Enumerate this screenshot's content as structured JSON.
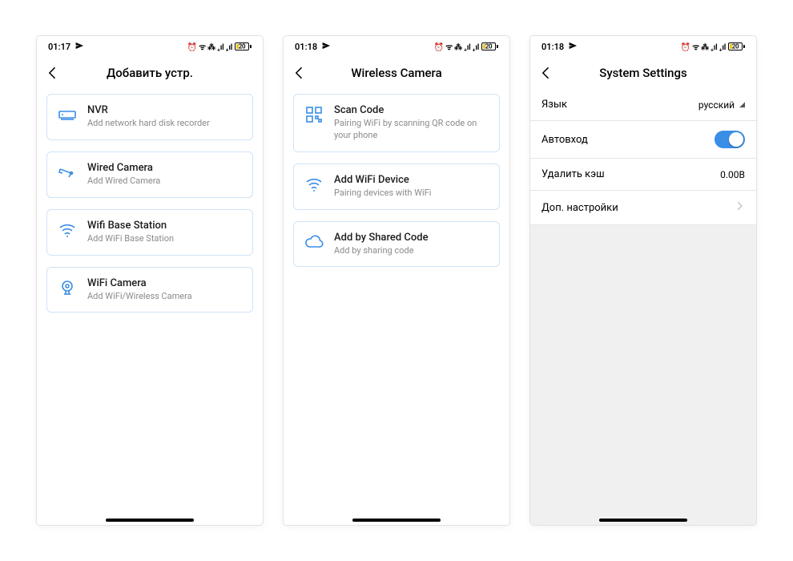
{
  "screens": [
    {
      "status": {
        "time": "01:17",
        "icons": "⏰ ᯤ ⁂ ₊ıl ₊ıl",
        "battery_pct": "20"
      },
      "nav": {
        "title": "Добавить устр."
      },
      "cards": [
        {
          "icon": "nvr-icon",
          "title": "NVR",
          "sub": "Add network hard disk recorder"
        },
        {
          "icon": "wired-cam-icon",
          "title": "Wired Camera",
          "sub": "Add Wired Camera"
        },
        {
          "icon": "wifi-base-icon",
          "title": "Wifi Base Station",
          "sub": "Add WiFi Base Station"
        },
        {
          "icon": "wifi-cam-icon",
          "title": "WiFi Camera",
          "sub": "Add WiFi/Wireless Camera"
        }
      ]
    },
    {
      "status": {
        "time": "01:18",
        "icons": "⏰ ᯤ ⁂ ₊ıl ₊ıl",
        "battery_pct": "20"
      },
      "nav": {
        "title": "Wireless Camera"
      },
      "cards": [
        {
          "icon": "qr-icon",
          "title": "Scan Code",
          "sub": "Pairing WiFi by scanning QR code on your phone"
        },
        {
          "icon": "wifi-icon",
          "title": "Add WiFi Device",
          "sub": "Pairing devices with WiFi"
        },
        {
          "icon": "cloud-icon",
          "title": "Add by Shared Code",
          "sub": "Add by sharing code"
        }
      ]
    },
    {
      "status": {
        "time": "01:18",
        "icons": "⏰ ᯤ ⁂ ₊ıl ₊ıl",
        "battery_pct": "20"
      },
      "nav": {
        "title": "System Settings"
      },
      "rows": [
        {
          "label": "Язык",
          "type": "select",
          "value": "русский"
        },
        {
          "label": "Автовход",
          "type": "toggle",
          "value": true
        },
        {
          "label": "Удалить кэш",
          "type": "value",
          "value": "0.00B"
        },
        {
          "label": "Доп. настройки",
          "type": "nav"
        }
      ]
    }
  ]
}
